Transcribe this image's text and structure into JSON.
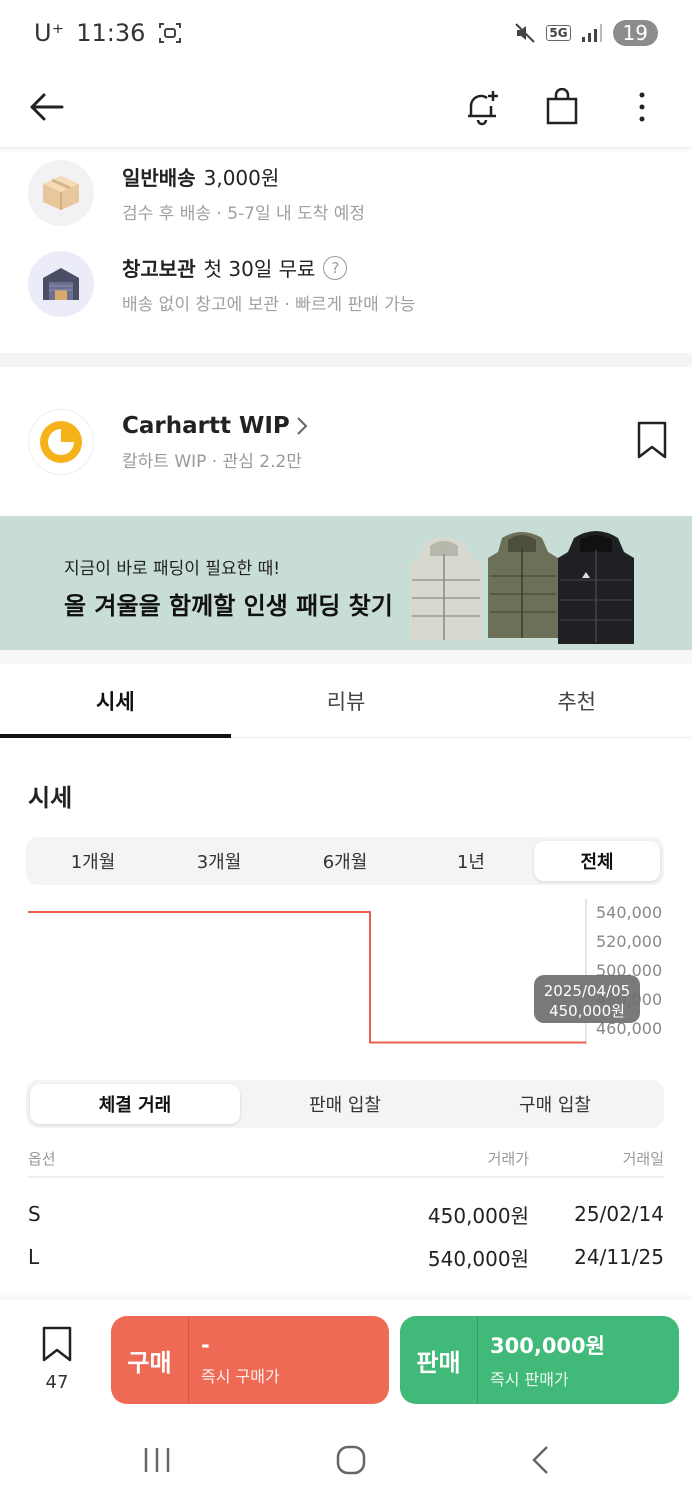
{
  "status_bar": {
    "carrier": "U⁺",
    "time": "11:36",
    "network": "5G",
    "battery": "19"
  },
  "shipping": [
    {
      "title_strong": "일반배송",
      "title_rest": "3,000원",
      "subtitle": "검수 후 배송  ·  5-7일 내 도착 예정",
      "icon": "box-icon"
    },
    {
      "title_strong": "창고보관",
      "title_rest": "첫 30일 무료",
      "subtitle": "배송 없이 창고에 보관  ·  빠르게 판매 가능",
      "icon": "warehouse-icon"
    }
  ],
  "brand": {
    "name": "Carhartt WIP",
    "subtitle": "칼하트 WIP · 관심 2.2만"
  },
  "banner": {
    "small_text": "지금이 바로 패딩이 필요한 때!",
    "big_text": "올 겨울을 함께할 인생 패딩 찾기"
  },
  "tabs": [
    "시세",
    "리뷰",
    "추천"
  ],
  "price_section": {
    "title": "시세",
    "periods": [
      "1개월",
      "3개월",
      "6개월",
      "1년",
      "전체"
    ],
    "active_period": "전체"
  },
  "chart_data": {
    "type": "line",
    "series": [
      {
        "points": [
          {
            "x": "start",
            "y": 540000
          },
          {
            "x": "2025/02/14",
            "y": 540000
          },
          {
            "x": "2025/02/14",
            "y": 450000
          },
          {
            "x": "2025/04/05",
            "y": 450000
          }
        ]
      }
    ],
    "y_ticks": [
      "540,000",
      "520,000",
      "500,000",
      "480,000",
      "460,000"
    ],
    "ylim": [
      460000,
      540000
    ],
    "line_color": "#e8604c",
    "tooltip": {
      "date": "2025/04/05",
      "value": "450,000원"
    }
  },
  "trade_tabs": [
    "체결 거래",
    "판매 입찰",
    "구매 입찰"
  ],
  "trade_table": {
    "headers": [
      "옵션",
      "거래가",
      "거래일"
    ],
    "rows": [
      {
        "option": "S",
        "price": "450,000원",
        "date": "25/02/14"
      },
      {
        "option": "L",
        "price": "540,000원",
        "date": "24/11/25"
      }
    ]
  },
  "bottom_bar": {
    "saved_count": "47",
    "buy": {
      "label": "구매",
      "price": "-",
      "sub": "즉시 구매가"
    },
    "sell": {
      "label": "판매",
      "price": "300,000원",
      "sub": "즉시 판매가"
    }
  },
  "colors": {
    "buy": "#ee6a55",
    "sell": "#41b979",
    "banner_bg": "#c9ddd7",
    "chart_line": "#e8604c"
  }
}
